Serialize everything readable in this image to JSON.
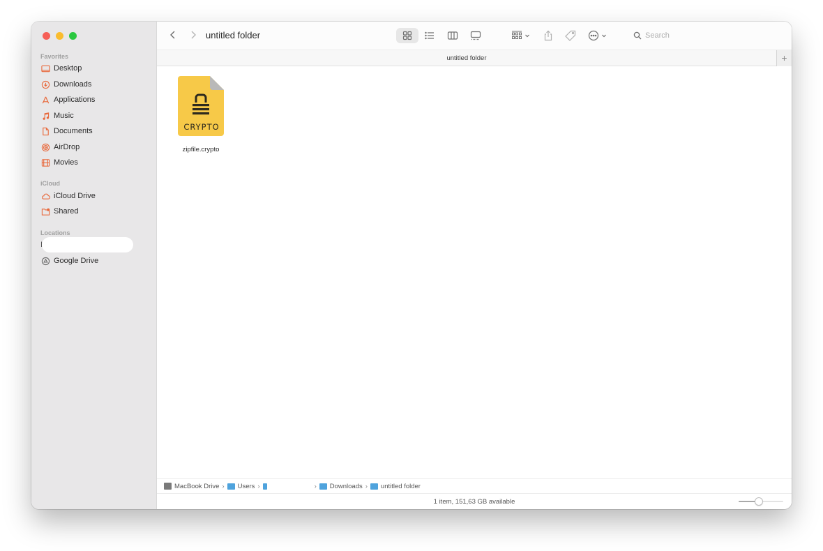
{
  "window": {
    "title": "untitled folder",
    "traffic_lights": [
      "close",
      "minimize",
      "maximize"
    ]
  },
  "sidebar": {
    "sections": [
      {
        "label": "Favorites",
        "items": [
          {
            "label": "Desktop",
            "icon": "desktop-icon"
          },
          {
            "label": "Downloads",
            "icon": "downloads-icon"
          },
          {
            "label": "Applications",
            "icon": "applications-icon"
          },
          {
            "label": "Music",
            "icon": "music-icon"
          },
          {
            "label": "Documents",
            "icon": "documents-icon"
          },
          {
            "label": "AirDrop",
            "icon": "airdrop-icon"
          },
          {
            "label": "Movies",
            "icon": "movies-icon"
          }
        ]
      },
      {
        "label": "iCloud",
        "items": [
          {
            "label": "iCloud Drive",
            "icon": "cloud-icon"
          },
          {
            "label": "Shared",
            "icon": "shared-folder-icon"
          }
        ]
      },
      {
        "label": "Locations",
        "items": [
          {
            "label": "",
            "icon": "redacted"
          },
          {
            "label": "Google Drive",
            "icon": "google-drive-icon"
          }
        ]
      }
    ],
    "accent_color": "#e8693c"
  },
  "toolbar": {
    "back_label": "‹",
    "forward_label": "›",
    "view_modes": [
      "icon",
      "list",
      "column",
      "gallery"
    ],
    "active_view": "icon",
    "search_placeholder": "Search"
  },
  "tab": {
    "title": "untitled folder",
    "add_label": "+"
  },
  "files": [
    {
      "name": "zipfile.crypto",
      "badge": "CRYPTO",
      "color": "#f7c948"
    }
  ],
  "pathbar": {
    "crumbs": [
      "MacBook Drive",
      "Users",
      "",
      "Downloads",
      "untitled folder"
    ],
    "separator": "›"
  },
  "status": {
    "text": "1 item, 151,63 GB available",
    "icon_size_slider": 0.45
  }
}
